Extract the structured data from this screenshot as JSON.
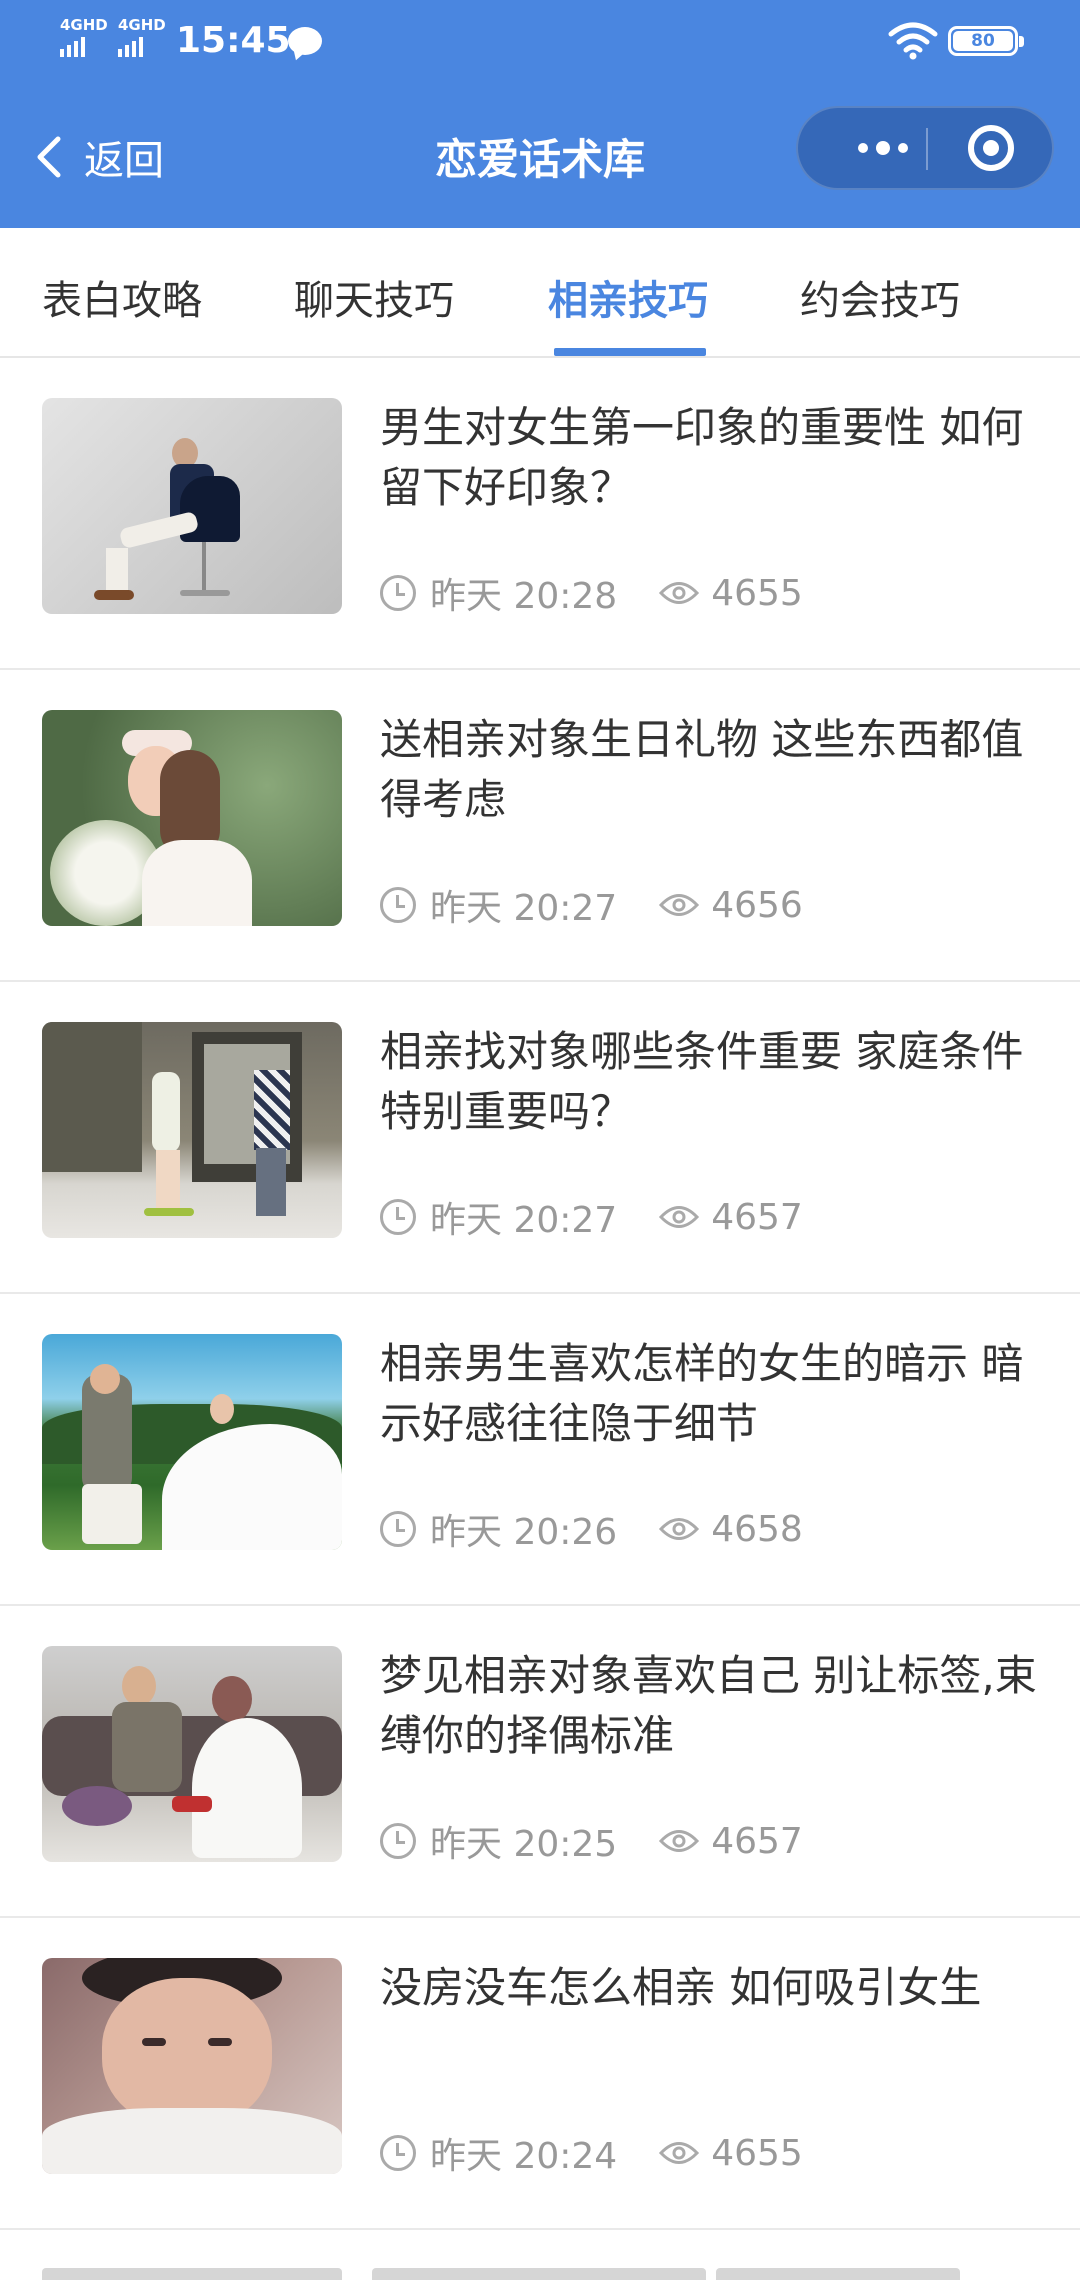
{
  "status_bar": {
    "network_1": "4GHD",
    "network_2": "4GHD",
    "time": "15:45",
    "battery": "80"
  },
  "nav": {
    "back_label": "返回",
    "title": "恋爱话术库"
  },
  "tabs": [
    {
      "label": "表白攻略"
    },
    {
      "label": "聊天技巧"
    },
    {
      "label": "相亲技巧",
      "active": true
    },
    {
      "label": "约会技巧"
    }
  ],
  "articles": [
    {
      "title": "男生对女生第一印象的重要性 如何留下好印象？",
      "time": "昨天 20:28",
      "views": "4655"
    },
    {
      "title": "送相亲对象生日礼物 这些东西都值得考虑",
      "time": "昨天 20:27",
      "views": "4656"
    },
    {
      "title": "相亲找对象哪些条件重要 家庭条件特别重要吗？",
      "time": "昨天 20:27",
      "views": "4657"
    },
    {
      "title": "相亲男生喜欢怎样的女生的暗示 暗示好感往往隐于细节",
      "time": "昨天 20:26",
      "views": "4658"
    },
    {
      "title": "梦见相亲对象喜欢自己 别让标签,束缚你的择偶标准",
      "time": "昨天 20:25",
      "views": "4657"
    },
    {
      "title": "没房没车怎么相亲 如何吸引女生",
      "time": "昨天 20:24",
      "views": "4655"
    }
  ],
  "colors": {
    "primary": "#4a86e0",
    "capsule": "#3568b8",
    "meta_text": "#999999"
  }
}
